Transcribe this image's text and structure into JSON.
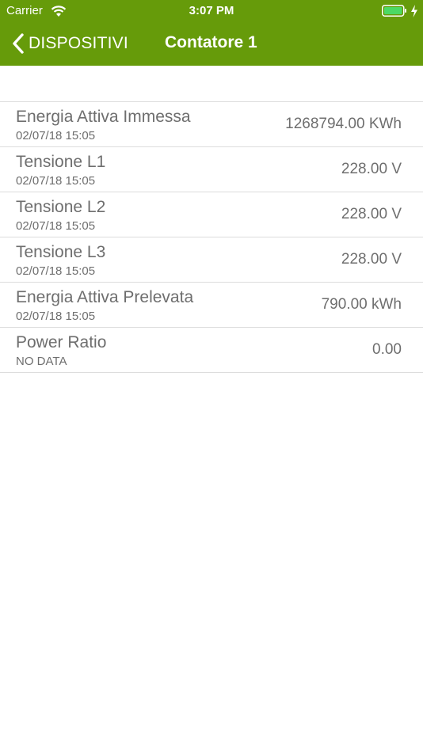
{
  "status_bar": {
    "carrier": "Carrier",
    "time": "3:07 PM"
  },
  "nav": {
    "back_label": "DISPOSITIVI",
    "title": "Contatore 1"
  },
  "colors": {
    "header_bg": "#669b0a",
    "text": "#6e6e6e",
    "separator": "#dcdcdc",
    "battery": "#4cd964"
  },
  "icons": {
    "back": "chevron-left-icon",
    "wifi": "wifi-icon",
    "battery": "battery-icon",
    "charging": "charging-bolt-icon"
  },
  "rows": [
    {
      "title": "Energia Attiva Immessa",
      "subtitle": "02/07/18 15:05",
      "value": "1268794.00 KWh"
    },
    {
      "title": "Tensione L1",
      "subtitle": "02/07/18 15:05",
      "value": "228.00 V"
    },
    {
      "title": "Tensione L2",
      "subtitle": "02/07/18 15:05",
      "value": "228.00 V"
    },
    {
      "title": "Tensione L3",
      "subtitle": "02/07/18 15:05",
      "value": "228.00 V"
    },
    {
      "title": "Energia Attiva Prelevata",
      "subtitle": "02/07/18 15:05",
      "value": "790.00 kWh"
    },
    {
      "title": "Power Ratio",
      "subtitle": "NO DATA",
      "value": "0.00"
    }
  ]
}
